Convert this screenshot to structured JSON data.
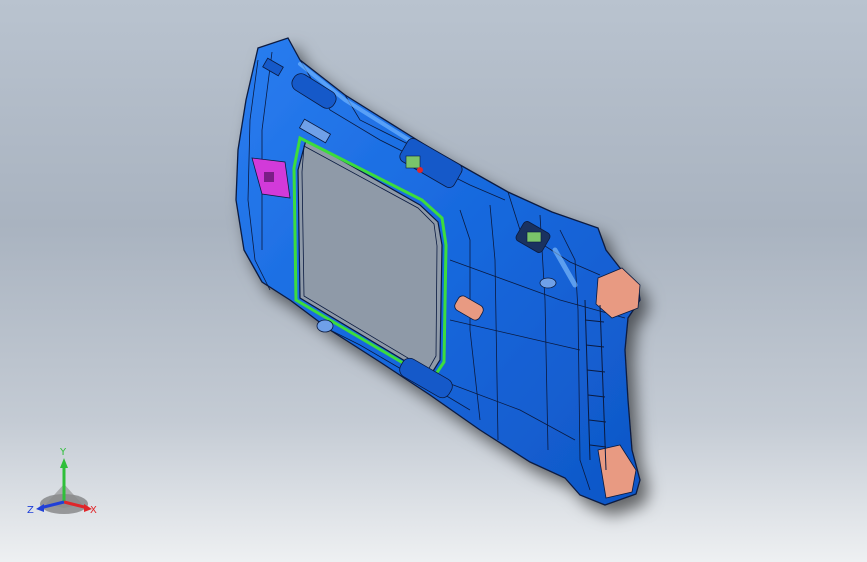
{
  "viewport": {
    "background_top": "#b9c3cf",
    "background_bottom": "#eef0f2"
  },
  "model": {
    "part_color": "#1e6fe0",
    "edge_color": "#0a1a40",
    "seal_color": "#3ddc3d",
    "accent_magenta": "#d23ad9",
    "accent_salmon": "#e89a82"
  },
  "triad": {
    "x_label": "X",
    "y_label": "Y",
    "z_label": "Z",
    "x_color": "#e0262a",
    "y_color": "#2fbf3a",
    "z_color": "#2040d8",
    "icon": "coordinate-triad-icon"
  }
}
